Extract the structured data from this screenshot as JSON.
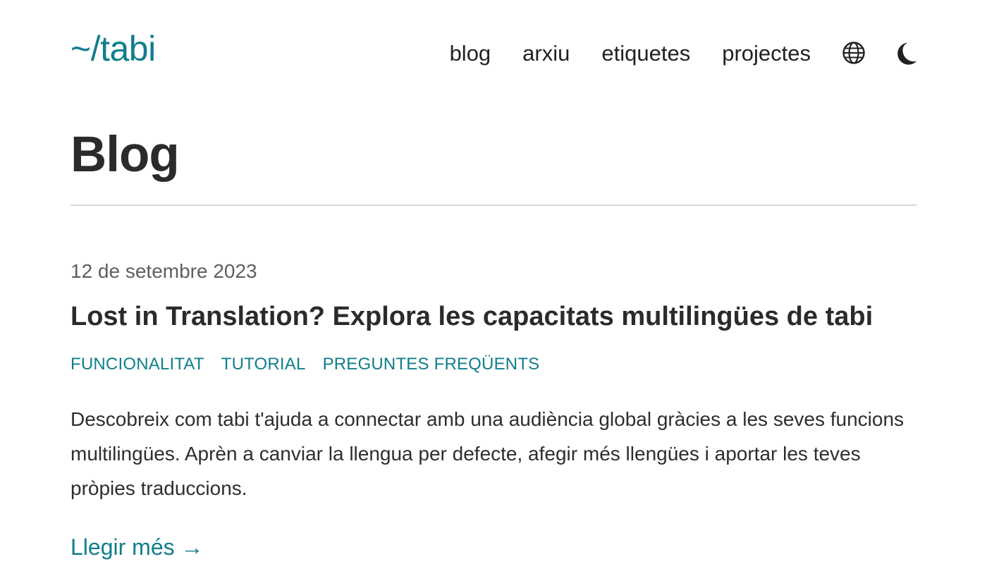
{
  "header": {
    "logo": "~/tabi",
    "nav": [
      {
        "label": "blog"
      },
      {
        "label": "arxiu"
      },
      {
        "label": "etiquetes"
      },
      {
        "label": "projectes"
      }
    ],
    "language_icon": "globe-icon",
    "theme_icon": "moon-icon"
  },
  "page": {
    "title": "Blog"
  },
  "posts": [
    {
      "date": "12 de setembre 2023",
      "title": "Lost in Translation? Explora les capacitats multilingües de tabi",
      "tags": [
        "FUNCIONALITAT",
        "TUTORIAL",
        "PREGUNTES FREQÜENTS"
      ],
      "summary": "Descobreix com tabi t'ajuda a connectar amb una audiència global gràcies a les seves funcions multilingües. Aprèn a canviar la llengua per defecte, afegir més llengües i aportar les teves pròpies traduccions.",
      "read_more": "Llegir més →"
    }
  ],
  "colors": {
    "accent": "#107e8c",
    "text": "#222222",
    "muted": "#5f5f5f",
    "rule": "#d9d9d9"
  }
}
